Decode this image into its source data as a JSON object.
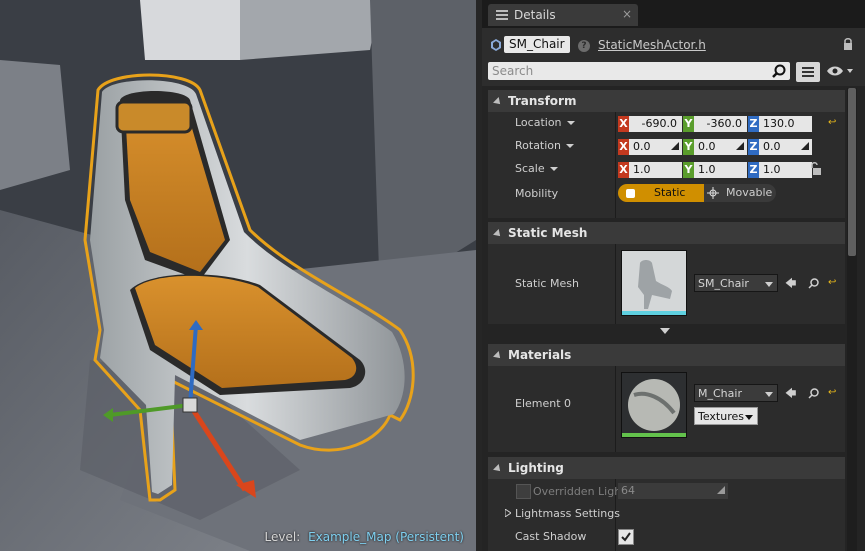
{
  "viewport": {
    "level_label": "Level:",
    "level_name": "Example_Map (Persistent)"
  },
  "details": {
    "tab_title": "Details",
    "tab_close": "×",
    "actor_name": "SM_Chair",
    "class_link": "StaticMeshActor.h",
    "search_placeholder": "Search",
    "transform": {
      "title": "Transform",
      "location": {
        "label": "Location",
        "x": "-690.0",
        "y": "-360.0",
        "z": "130.0"
      },
      "rotation": {
        "label": "Rotation",
        "x": "0.0",
        "y": "0.0",
        "z": "0.0"
      },
      "scale": {
        "label": "Scale",
        "x": "1.0",
        "y": "1.0",
        "z": "1.0"
      },
      "mobility": {
        "label": "Mobility",
        "options": [
          "Static",
          "Movable"
        ],
        "selected": "Static"
      }
    },
    "static_mesh": {
      "title": "Static Mesh",
      "label": "Static Mesh",
      "value": "SM_Chair"
    },
    "materials": {
      "title": "Materials",
      "label": "Element 0",
      "value": "M_Chair",
      "textures_button": "Textures"
    },
    "lighting": {
      "title": "Lighting",
      "overridden_label": "Overridden Ligh",
      "overridden_value": "64",
      "lightmass_label": "Lightmass Settings",
      "cast_shadow_label": "Cast Shadow",
      "cast_shadow_checked": true
    },
    "axis_letters": {
      "x": "X",
      "y": "Y",
      "z": "Z"
    },
    "colors": {
      "axis_x": "#c3391f",
      "axis_y": "#5a9d2c",
      "axis_z": "#2f6bc2",
      "static_selected": "#d08f00",
      "selection_outline": "#e8a21a"
    }
  }
}
